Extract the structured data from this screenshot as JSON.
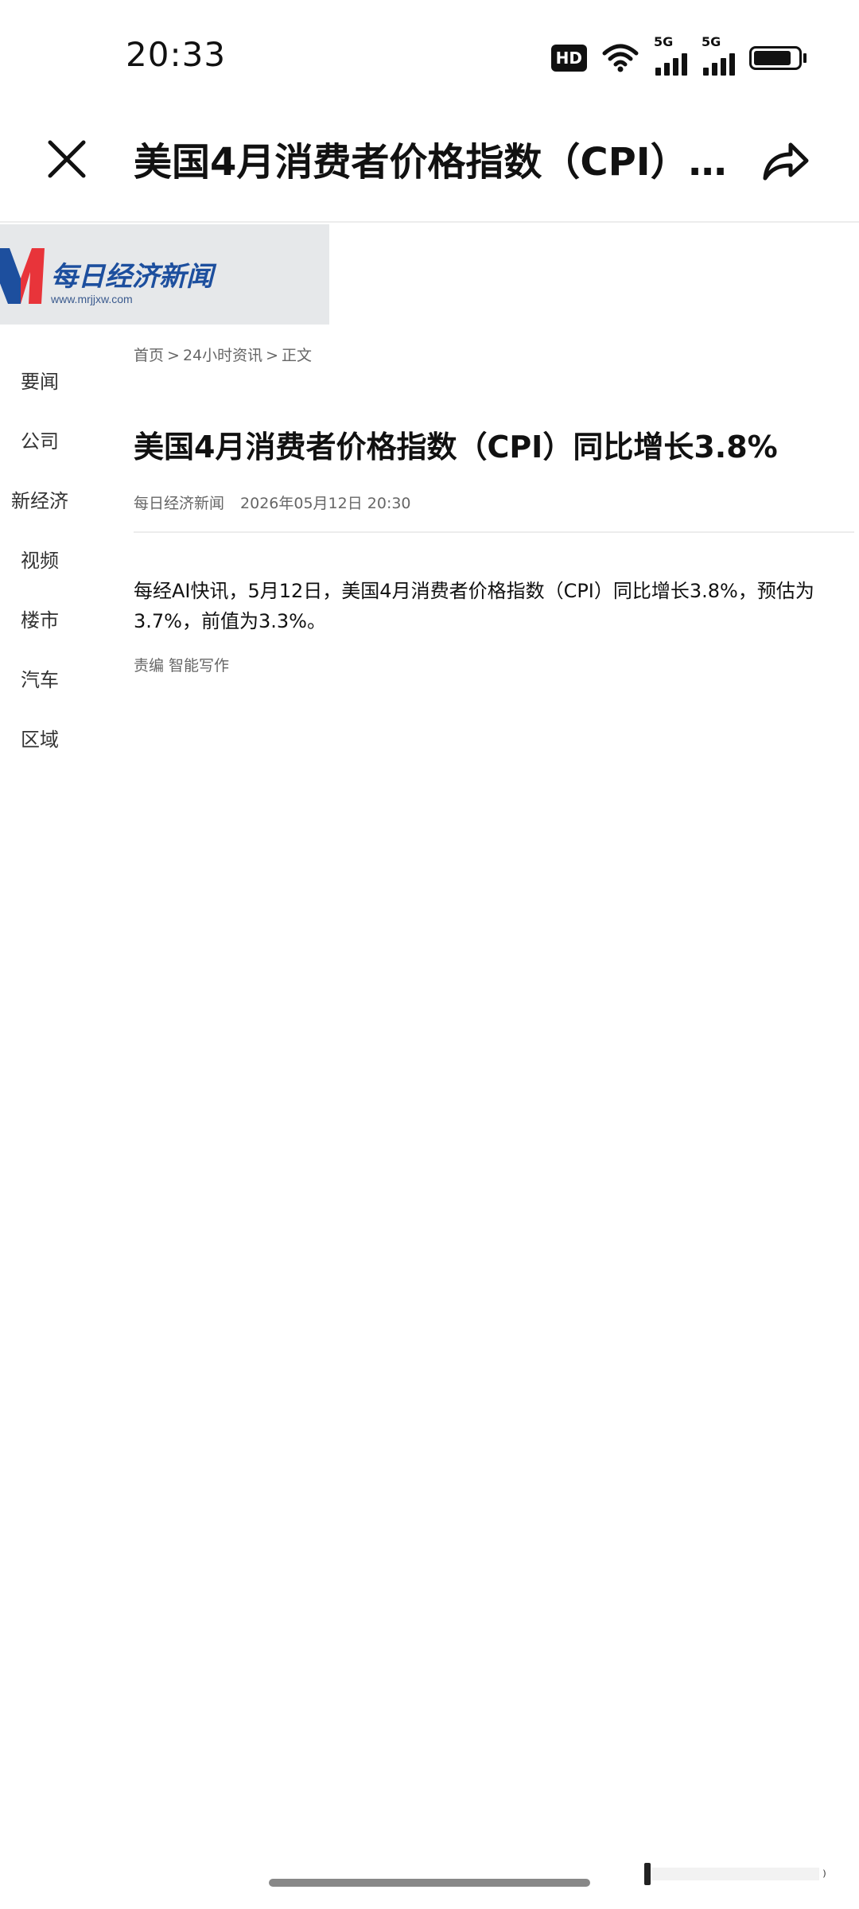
{
  "status_bar": {
    "time": "20:33",
    "hd_label": "HD",
    "signal_1_label": "5G",
    "signal_2_label": "5G",
    "battery_level": 0.85,
    "icons": [
      "hd-voice-icon",
      "wifi-icon",
      "signal-5g-icon",
      "signal-5g-icon",
      "battery-icon"
    ]
  },
  "top_bar": {
    "title": "美国4月消费者价格指数（CPI）同比增长3.8%",
    "close_icon": "close-icon",
    "share_icon": "share-icon"
  },
  "logo": {
    "name": "每日经济新闻",
    "url": "www.mrjjxw.com",
    "brand_color": "#1d4f9e",
    "accent_color": "#e8343a"
  },
  "side_nav": {
    "items": [
      {
        "label": "要闻"
      },
      {
        "label": "公司"
      },
      {
        "label": "新经济"
      },
      {
        "label": "视频"
      },
      {
        "label": "楼市"
      },
      {
        "label": "汽车"
      },
      {
        "label": "区域"
      }
    ]
  },
  "breadcrumb": {
    "home": "首页",
    "section": "24小时资讯",
    "current": "正文",
    "separator": ">"
  },
  "article": {
    "title": "美国4月消费者价格指数（CPI）同比增长3.8%",
    "source": "每日经济新闻",
    "date": "2026年05月12日 20:30",
    "body": "每经AI快讯，5月12日，美国4月消费者价格指数（CPI）同比增长3.8%，预估为3.7%，前值为3.3%。",
    "editor": "责编 智能写作"
  }
}
